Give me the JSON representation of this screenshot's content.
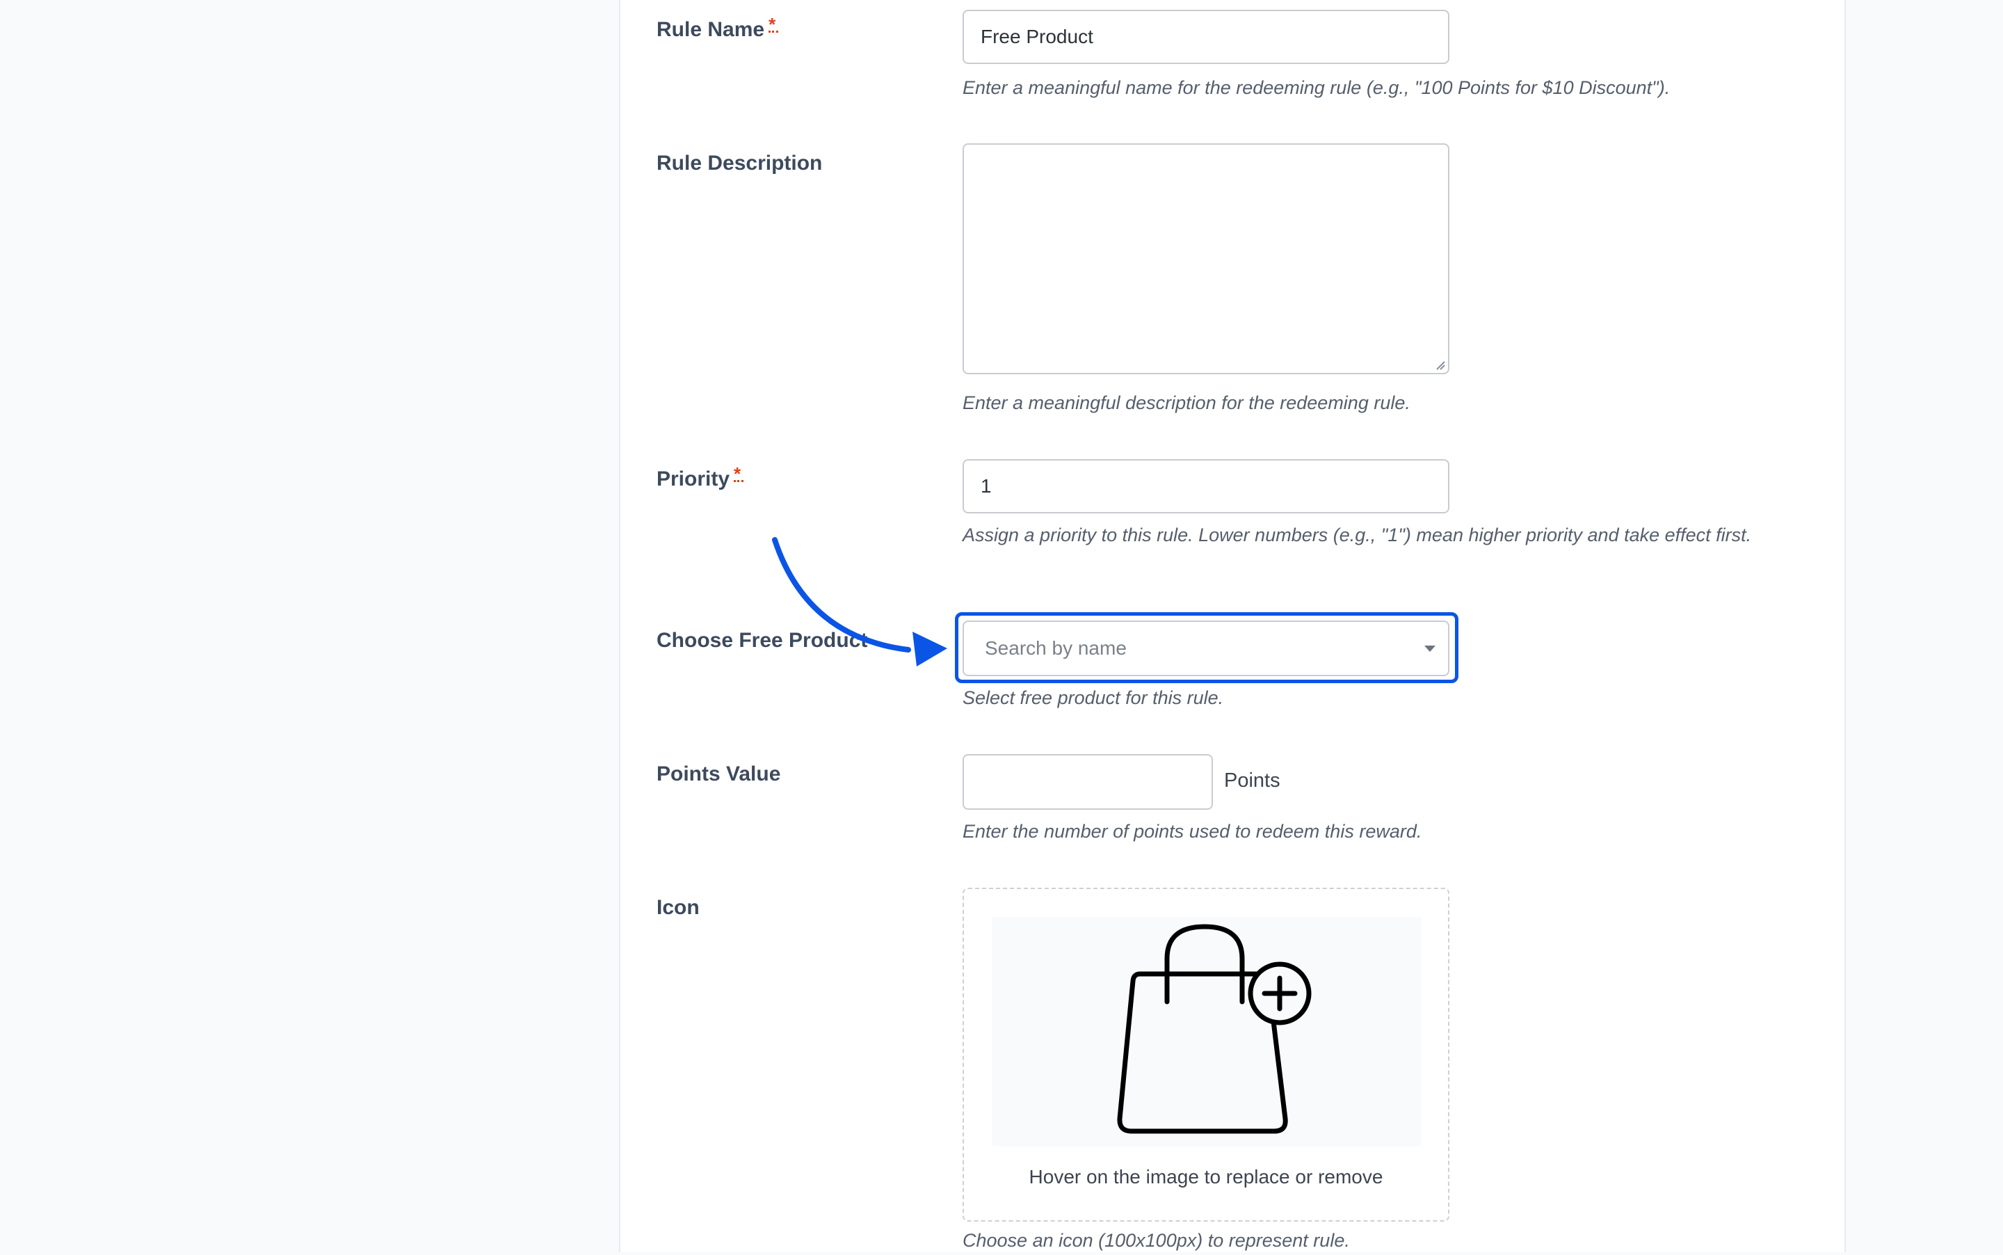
{
  "form": {
    "rule_name": {
      "label": "Rule Name",
      "required_mark": "*",
      "value": "Free Product",
      "help": "Enter a meaningful name for the redeeming rule (e.g., \"100 Points for $10 Discount\")."
    },
    "rule_description": {
      "label": "Rule Description",
      "value": "",
      "help": "Enter a meaningful description for the redeeming rule."
    },
    "priority": {
      "label": "Priority",
      "required_mark": "*",
      "value": "1",
      "help": "Assign a priority to this rule. Lower numbers (e.g., \"1\") mean higher priority and take effect first."
    },
    "free_product": {
      "label": "Choose Free Product",
      "placeholder": "Search by name",
      "help": "Select free product for this rule."
    },
    "points_value": {
      "label": "Points Value",
      "value": "",
      "unit": "Points",
      "help": "Enter the number of points used to redeem this reward."
    },
    "icon": {
      "label": "Icon",
      "icon_name": "shopping-bag-plus-icon",
      "hint": "Hover on the image to replace or remove",
      "help": "Choose an icon (100x100px) to represent rule."
    }
  },
  "colors": {
    "highlight": "#0b55e6",
    "required": "#e2401c",
    "label": "#3d4a5c"
  }
}
